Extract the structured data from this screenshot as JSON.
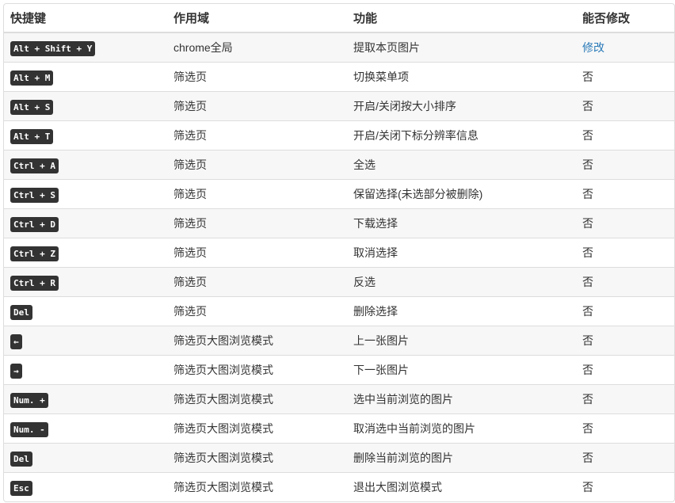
{
  "headers": [
    "快捷键",
    "作用域",
    "功能",
    "能否修改"
  ],
  "rows": [
    {
      "key": "Alt + Shift + Y",
      "scope": "chrome全局",
      "func": "提取本页图片",
      "edit": "修改",
      "edit_link": true
    },
    {
      "key": "Alt + M",
      "scope": "筛选页",
      "func": "切换菜单项",
      "edit": "否"
    },
    {
      "key": "Alt + S",
      "scope": "筛选页",
      "func": "开启/关闭按大小排序",
      "edit": "否"
    },
    {
      "key": "Alt + T",
      "scope": "筛选页",
      "func": "开启/关闭下标分辨率信息",
      "edit": "否"
    },
    {
      "key": "Ctrl + A",
      "scope": "筛选页",
      "func": "全选",
      "edit": "否"
    },
    {
      "key": "Ctrl + S",
      "scope": "筛选页",
      "func": "保留选择(未选部分被删除)",
      "edit": "否"
    },
    {
      "key": "Ctrl + D",
      "scope": "筛选页",
      "func": "下载选择",
      "edit": "否"
    },
    {
      "key": "Ctrl + Z",
      "scope": "筛选页",
      "func": "取消选择",
      "edit": "否"
    },
    {
      "key": "Ctrl + R",
      "scope": "筛选页",
      "func": "反选",
      "edit": "否"
    },
    {
      "key": "Del",
      "scope": "筛选页",
      "func": "删除选择",
      "edit": "否"
    },
    {
      "key": "←",
      "scope": "筛选页大图浏览模式",
      "func": "上一张图片",
      "edit": "否"
    },
    {
      "key": "→",
      "scope": "筛选页大图浏览模式",
      "func": "下一张图片",
      "edit": "否"
    },
    {
      "key": "Num. +",
      "scope": "筛选页大图浏览模式",
      "func": "选中当前浏览的图片",
      "edit": "否"
    },
    {
      "key": "Num. -",
      "scope": "筛选页大图浏览模式",
      "func": "取消选中当前浏览的图片",
      "edit": "否"
    },
    {
      "key": "Del",
      "scope": "筛选页大图浏览模式",
      "func": "删除当前浏览的图片",
      "edit": "否"
    },
    {
      "key": "Esc",
      "scope": "筛选页大图浏览模式",
      "func": "退出大图浏览模式",
      "edit": "否"
    }
  ]
}
